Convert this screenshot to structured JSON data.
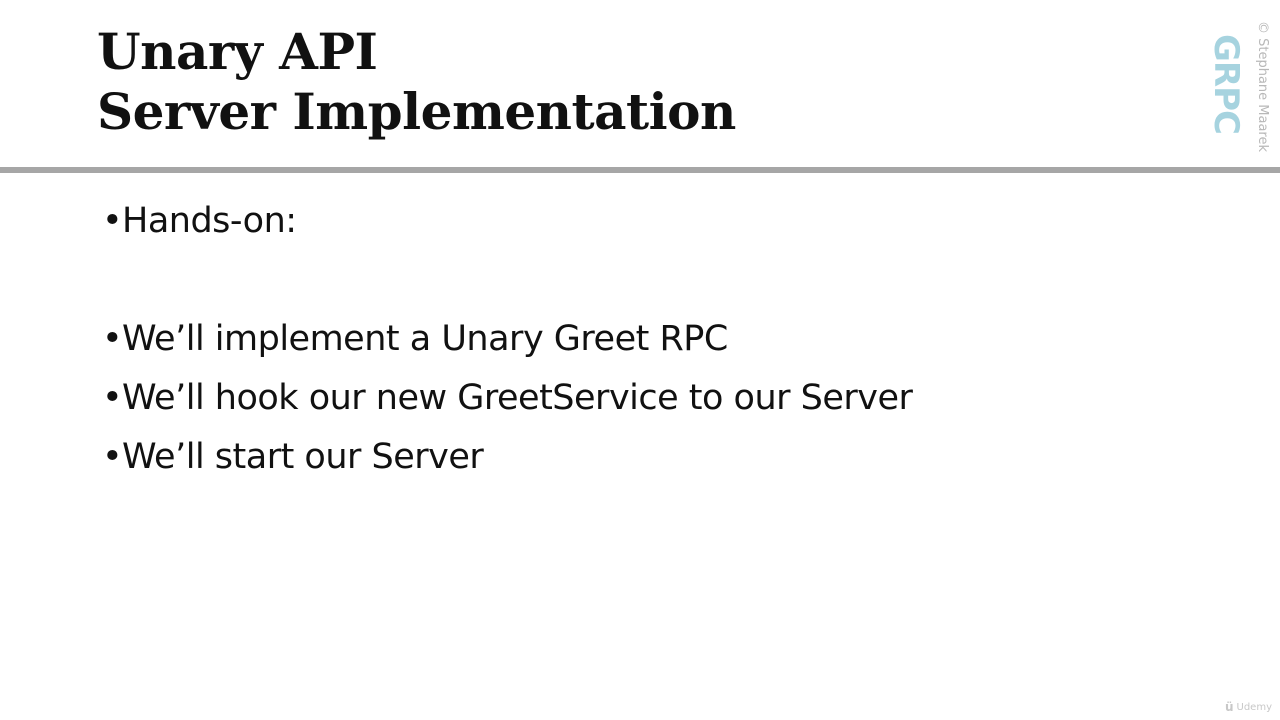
{
  "slide": {
    "title_line1": "Unary API",
    "title_line2": "Server Implementation",
    "bullet_symbol": "•",
    "bullets": [
      "Hands-on:",
      "We’ll implement a Unary Greet RPC",
      "We’ll hook our new GreetService to our Server",
      "We’ll start our Server"
    ],
    "logo_text": "GRPC",
    "copyright": "© Stephane Maarek",
    "watermark_mark": "ü",
    "watermark_text": "Udemy"
  },
  "colors": {
    "text": "#111111",
    "divider": "#a6a6a6",
    "logo": "#a6d3df",
    "copyright": "#b8b8b8"
  }
}
